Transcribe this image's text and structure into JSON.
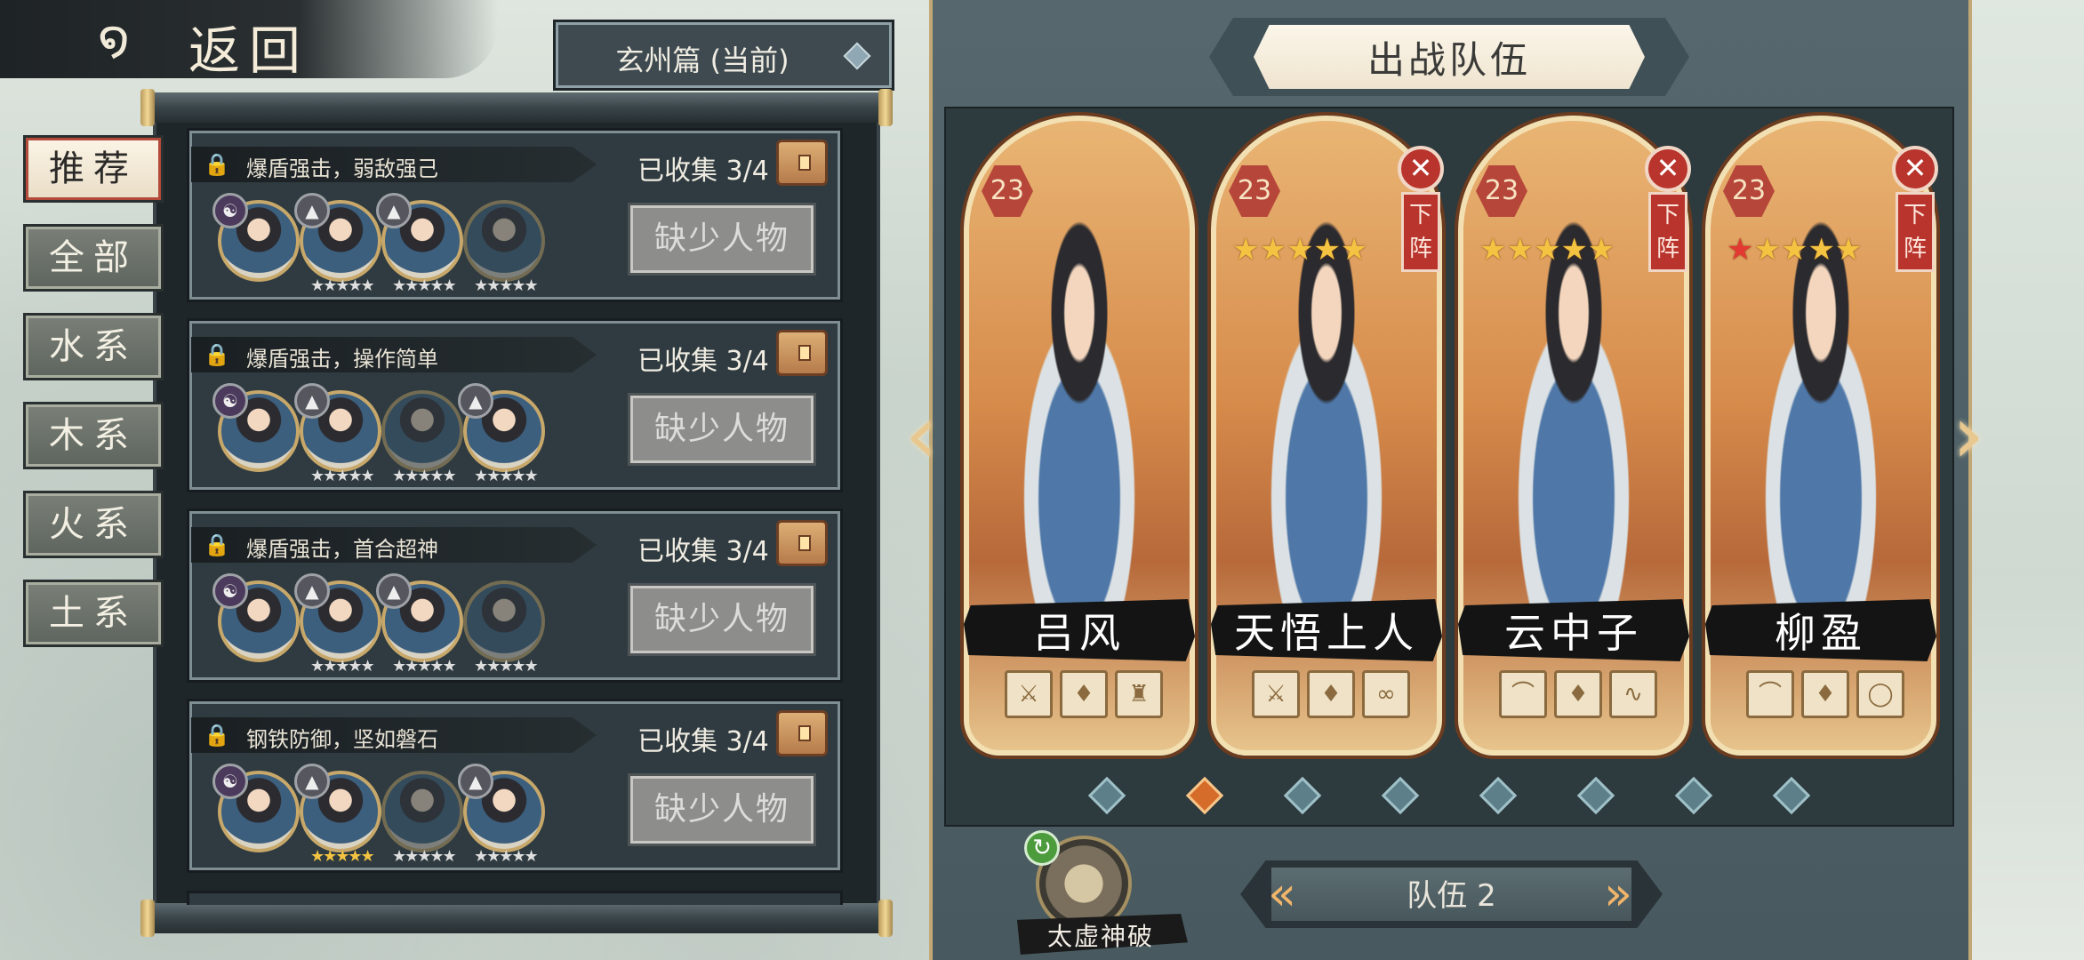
{
  "back": {
    "label": "返回"
  },
  "chapter": {
    "label": "玄州篇 (当前)"
  },
  "tabs": [
    {
      "label": "推荐",
      "active": true
    },
    {
      "label": "全部"
    },
    {
      "label": "水系"
    },
    {
      "label": "木系"
    },
    {
      "label": "火系"
    },
    {
      "label": "土系"
    }
  ],
  "teams": [
    {
      "title": "爆盾强击，弱敌强己",
      "count": "已收集 3/4",
      "button": "缺少人物"
    },
    {
      "title": "爆盾强击，操作简单",
      "count": "已收集 3/4",
      "button": "缺少人物"
    },
    {
      "title": "爆盾强击，首合超神",
      "count": "已收集 3/4",
      "button": "缺少人物"
    },
    {
      "title": "钢铁防御，坚如磐石",
      "count": "已收集 3/4",
      "button": "缺少人物"
    }
  ],
  "panel": {
    "title": "出战队伍"
  },
  "heroes": [
    {
      "name": "吕风",
      "level": "23",
      "stars": 0,
      "removable": false
    },
    {
      "name": "天悟上人",
      "level": "23",
      "stars": 5,
      "removable": true
    },
    {
      "name": "云中子",
      "level": "23",
      "stars": 5,
      "removable": true
    },
    {
      "name": "柳盈",
      "level": "23",
      "stars": 5,
      "removable": true
    }
  ],
  "remove_label": "下\n阵",
  "team_selector": {
    "label": "队伍 2"
  },
  "skill": {
    "name": "太虚神破"
  },
  "colors": {
    "accent": "#c2a874",
    "remove": "#b8342c",
    "star": "#f3c341"
  }
}
